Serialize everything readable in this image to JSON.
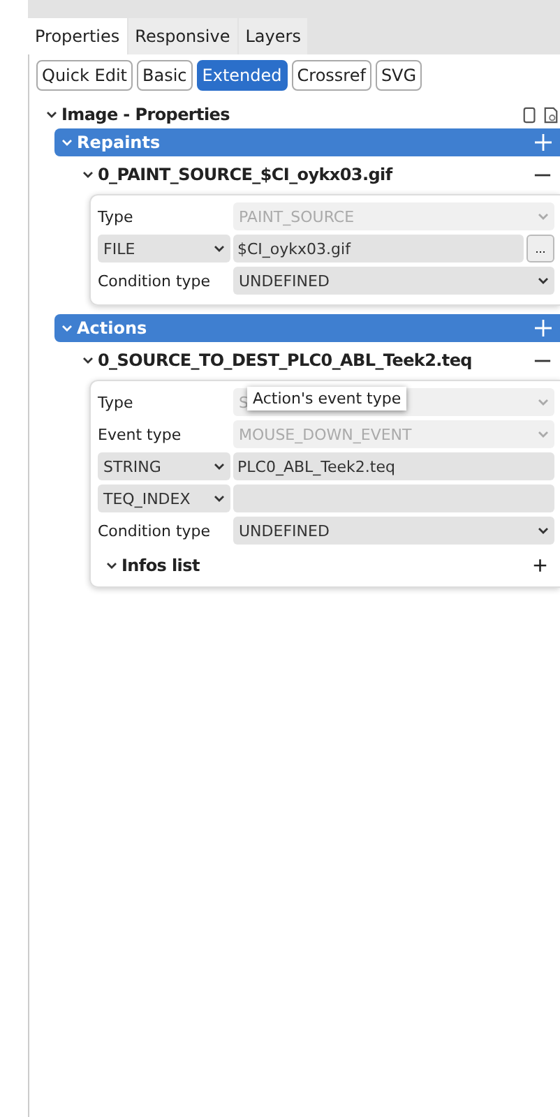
{
  "tabs": [
    {
      "label": "Properties",
      "selected": true
    },
    {
      "label": "Responsive",
      "selected": false
    },
    {
      "label": "Layers",
      "selected": false
    }
  ],
  "modes": [
    {
      "label": "Quick Edit",
      "selected": false
    },
    {
      "label": "Basic",
      "selected": false
    },
    {
      "label": "Extended",
      "selected": true
    },
    {
      "label": "Crossref",
      "selected": false
    },
    {
      "label": "SVG",
      "selected": false
    }
  ],
  "panel_title": "Image - Properties",
  "sections": [
    {
      "title": "Repaints",
      "items": [
        {
          "title": "0_PAINT_SOURCE_$CI_oykx03.gif",
          "rows": [
            {
              "kind": "select",
              "label": "Type",
              "value": "PAINT_SOURCE",
              "disabled": true
            },
            {
              "kind": "typed",
              "type": "FILE",
              "value": "$CI_oykx03.gif",
              "browse": "..."
            },
            {
              "kind": "select",
              "label": "Condition type",
              "value": "UNDEFINED",
              "disabled": false
            }
          ]
        }
      ]
    },
    {
      "title": "Actions",
      "items": [
        {
          "title": "0_SOURCE_TO_DEST_PLC0_ABL_Teek2.teq",
          "tooltip": "Action's event type",
          "rows": [
            {
              "kind": "select",
              "label": "Type",
              "value": "S",
              "disabled": true
            },
            {
              "kind": "select",
              "label": "Event type",
              "value": "MOUSE_DOWN_EVENT",
              "disabled": true
            },
            {
              "kind": "typed",
              "type": "STRING",
              "value": "PLC0_ABL_Teek2.teq"
            },
            {
              "kind": "typed",
              "type": "TEQ_INDEX",
              "value": ""
            },
            {
              "kind": "select",
              "label": "Condition type",
              "value": "UNDEFINED",
              "disabled": false
            }
          ],
          "sublist": {
            "title": "Infos list",
            "add": "+"
          }
        }
      ]
    }
  ]
}
